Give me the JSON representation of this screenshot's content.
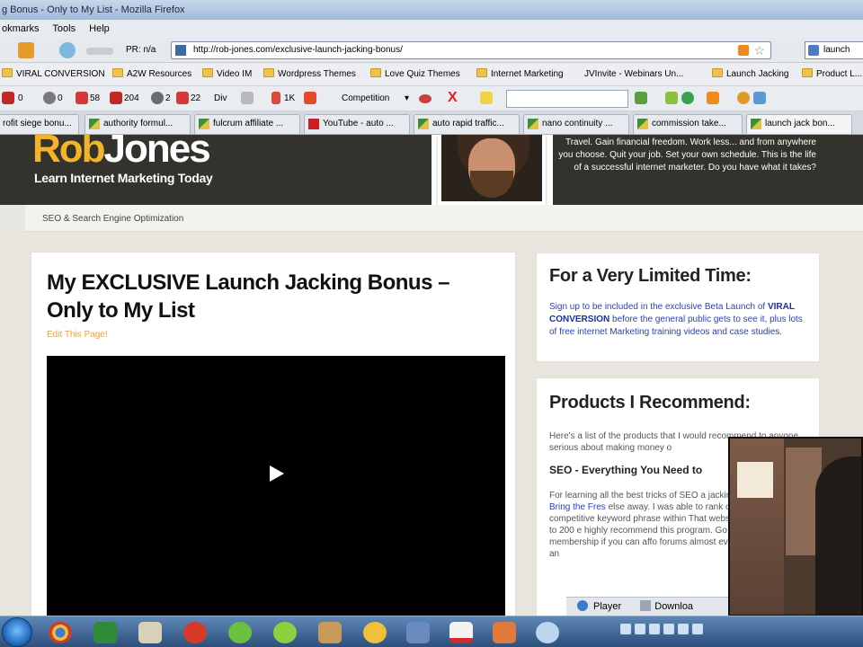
{
  "window": {
    "title": "g Bonus - Only to My List - Mozilla Firefox"
  },
  "menu": {
    "items": [
      "okmarks",
      "Tools",
      "Help"
    ]
  },
  "navbar": {
    "pr_label": "PR: n/a",
    "url": "http://rob-jones.com/exclusive-launch-jacking-bonus/",
    "search_value": "launch"
  },
  "bookmarks": {
    "items": [
      {
        "label": "VIRAL CONVERSION"
      },
      {
        "label": "A2W Resources"
      },
      {
        "label": "Video IM"
      },
      {
        "label": "Wordpress Themes"
      },
      {
        "label": "Love Quiz Themes"
      },
      {
        "label": "Internet Marketing"
      },
      {
        "label": "JVInvite - Webinars Un..."
      },
      {
        "label": "Launch Jacking"
      },
      {
        "label": "Product L..."
      }
    ]
  },
  "toolbar2": {
    "counters": [
      "0",
      "0",
      "58",
      "204",
      "2",
      "22",
      "Div",
      "1K"
    ],
    "competition_label": "Competition"
  },
  "tabs": [
    {
      "label": "rofit siege bonu...",
      "kind": "wp"
    },
    {
      "label": "authority formul...",
      "kind": "wp"
    },
    {
      "label": "fulcrum affiliate ...",
      "kind": "wp"
    },
    {
      "label": "YouTube - auto ...",
      "kind": "yt"
    },
    {
      "label": "auto rapid traffic...",
      "kind": "wp"
    },
    {
      "label": "nano continuity ...",
      "kind": "wp"
    },
    {
      "label": "commission take...",
      "kind": "wp"
    },
    {
      "label": "launch jack bon...",
      "kind": "wp"
    }
  ],
  "site": {
    "logo_first": "Rob",
    "logo_last": "Jones",
    "tagline": "Learn Internet Marketing Today",
    "header_blurb": "Travel. Gain financial freedom. Work less... and from anywhere you choose. Quit your job. Set your own schedule. This is the life of a successful internet marketer. Do you have what it takes?",
    "breadcrumb": "SEO & Search Engine Optimization"
  },
  "post": {
    "title": "My EXCLUSIVE Launch Jacking Bonus – Only to My List",
    "edit_link": "Edit This Page!"
  },
  "sidebar": {
    "box1_title": "For a Very Limited Time:",
    "box1_text_a": "Sign up to be included in the exclusive Beta Launch of ",
    "box1_text_b": "VIRAL CONVERSION",
    "box1_text_c": " before the general public gets to see it, plus lots of free internet Marketing training videos and case studies.",
    "box2_title": "Products I Recommend:",
    "box2_intro": "Here's a list of the products that I would recommend to anyone serious about making money o",
    "box2_sub": "SEO - Everything You Need to",
    "box2_body_a": "For learning all the best tricks of SEO a jacking, Mike and Kelly at ",
    "box2_body_link": "Bring the Fres",
    "box2_body_b": " else away. I was able to rank on page 1 very competitive keyword phrase within That website now gets close to 200 e highly recommend this program. Go fo disclosure membership if you can affo forums almost every day over there, an"
  },
  "statusbar": {
    "player": "Player",
    "downloads": "Downloa"
  }
}
